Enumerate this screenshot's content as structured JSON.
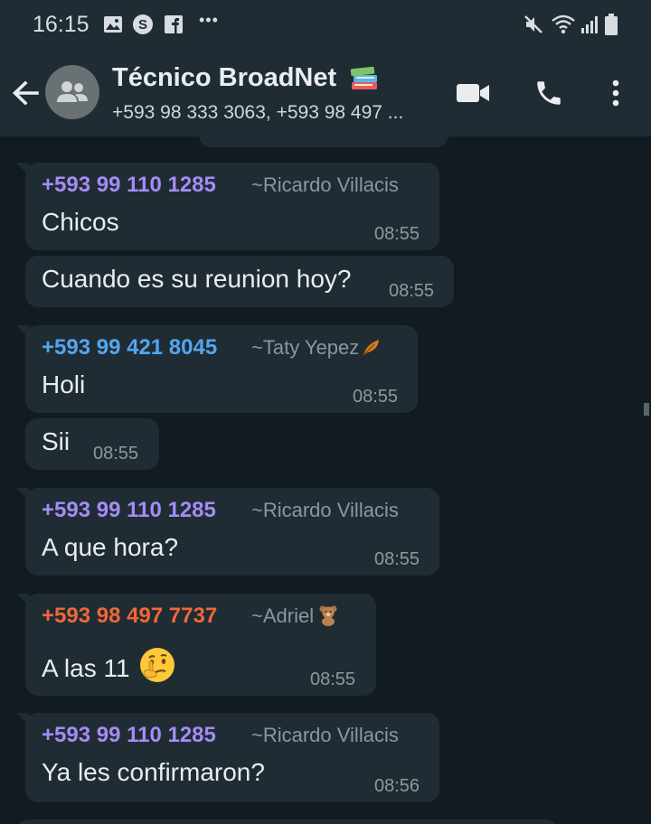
{
  "status_bar": {
    "time": "16:15",
    "ellipsis": "•••",
    "notification_icons": [
      "gallery-icon",
      "skype-icon",
      "facebook-icon"
    ],
    "system_icons": [
      "mute-icon",
      "wifi-icon",
      "signal-icon",
      "battery-icon"
    ]
  },
  "header": {
    "title": "Técnico BroadNet",
    "title_emoji": "books-emoji",
    "subtitle": "+593 98 333 3063, +593 98 497 ...",
    "actions": [
      "video-call-icon",
      "voice-call-icon",
      "more-options-icon"
    ]
  },
  "colors": {
    "header_bg": "#1f2c34",
    "chat_bg": "#121b22",
    "bubble_bg": "#202c33",
    "sender_purple": "#a48cf5",
    "sender_blue": "#53a6f2",
    "sender_orange": "#f0663a"
  },
  "messages": [
    {
      "sender": "+593 99 110 1285",
      "alias": "~Ricardo Villacis",
      "text": "Chicos",
      "time": "08:55"
    },
    {
      "text": "Cuando es su reunion hoy?",
      "time": "08:55"
    },
    {
      "sender": "+593 99 421 8045",
      "alias": "~Taty Yepez",
      "text": "Holi",
      "time": "08:55"
    },
    {
      "text": "Sii",
      "time": "08:55"
    },
    {
      "sender": "+593 99 110 1285",
      "alias": "~Ricardo Villacis",
      "text": "A que hora?",
      "time": "08:55"
    },
    {
      "sender": "+593 98 497 7737",
      "alias": "~Adriel",
      "text": "A las 11",
      "time": "08:55"
    },
    {
      "sender": "+593 99 110 1285",
      "alias": "~Ricardo Villacis",
      "text": "Ya les confirmaron?",
      "time": "08:56"
    }
  ]
}
